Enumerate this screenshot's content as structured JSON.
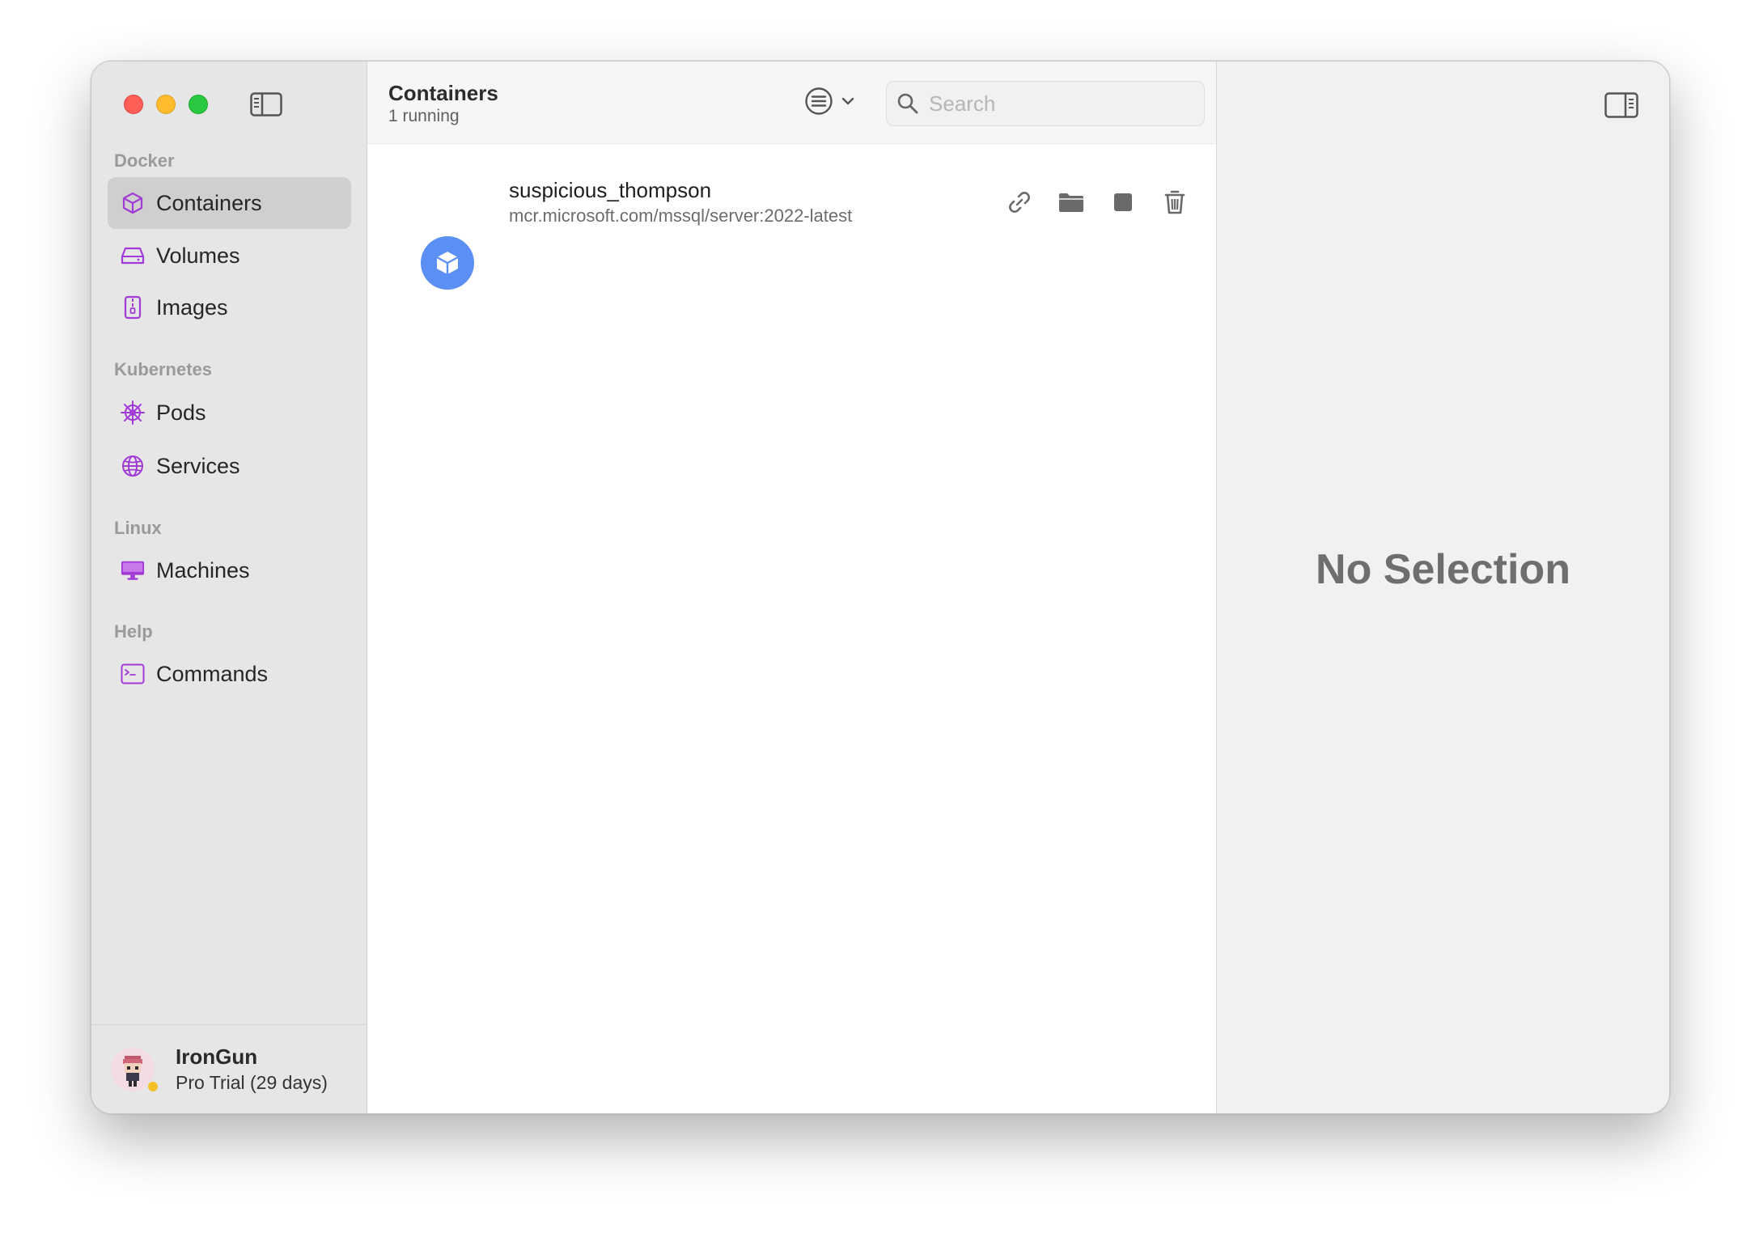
{
  "sidebar": {
    "sections": [
      {
        "label": "Docker"
      },
      {
        "label": "Kubernetes"
      },
      {
        "label": "Linux"
      },
      {
        "label": "Help"
      }
    ],
    "items": [
      {
        "label": "Containers",
        "icon": "cube-icon"
      },
      {
        "label": "Volumes",
        "icon": "drive-icon"
      },
      {
        "label": "Images",
        "icon": "archive-icon"
      },
      {
        "label": "Pods",
        "icon": "helm-wheel-icon"
      },
      {
        "label": "Services",
        "icon": "globe-icon"
      },
      {
        "label": "Machines",
        "icon": "display-icon"
      },
      {
        "label": "Commands",
        "icon": "terminal-icon"
      }
    ],
    "user": {
      "name": "IronGun",
      "plan": "Pro Trial (29 days)"
    }
  },
  "main": {
    "title": "Containers",
    "subtitle": "1 running",
    "search": {
      "placeholder": "Search",
      "value": ""
    },
    "containers": [
      {
        "name": "suspicious_thompson",
        "image": "mcr.microsoft.com/mssql/server:2022-latest",
        "status": "running"
      }
    ]
  },
  "detail": {
    "empty_label": "No Selection"
  },
  "colors": {
    "accent": "#a23bd6",
    "container_running": "#5b8ff3",
    "close": "#ff5f57",
    "minimize": "#febc2e",
    "maximize": "#28c840"
  }
}
